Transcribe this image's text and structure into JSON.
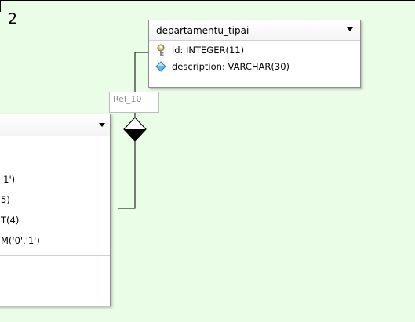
{
  "page": {
    "number": "2"
  },
  "tables": {
    "departamentu_tipai": {
      "name": "departamentu_tipai",
      "columns": [
        {
          "icon": "key-icon",
          "text": "id: INTEGER(11)"
        },
        {
          "icon": "diamond-icon",
          "text": "description: VARCHAR(30)"
        }
      ]
    },
    "partial": {
      "name": "",
      "columns": [
        {
          "text": "'1')"
        },
        {
          "text": "5)"
        },
        {
          "text": "T(4)"
        },
        {
          "text": "M('0','1')"
        }
      ]
    }
  },
  "relation": {
    "label": "Rel_10"
  },
  "colors": {
    "canvas": "#eafde6",
    "border": "#8e8e8e",
    "diamond": "#000000"
  }
}
